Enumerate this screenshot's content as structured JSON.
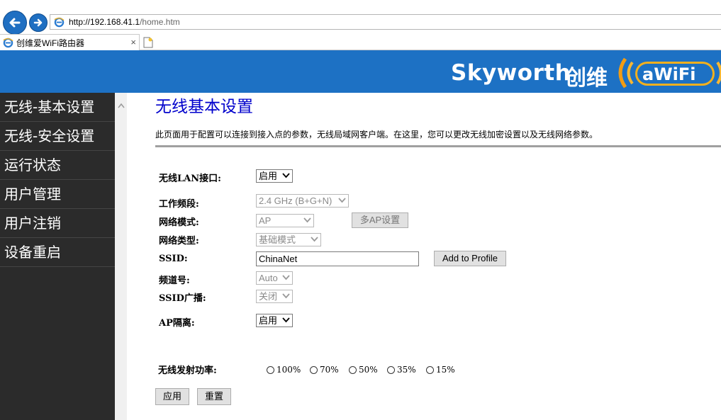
{
  "browser": {
    "url_host": "http://192.168.41.1",
    "url_path": "/home.htm",
    "tab_title": "创维爱WiFi路由器",
    "tab_close": "×"
  },
  "header": {
    "brand": "Skyworth",
    "brand_cn": "创维",
    "logo_text": "aWiFi",
    "color": "#1d71c4"
  },
  "sidebar": {
    "items": [
      {
        "label": "无线-基本设置"
      },
      {
        "label": "无线-安全设置"
      },
      {
        "label": "运行状态"
      },
      {
        "label": "用户管理"
      },
      {
        "label": "用户注销"
      },
      {
        "label": "设备重启"
      }
    ]
  },
  "main": {
    "title": "无线基本设置",
    "description": "此页面用于配置可以连接到接入点的参数，无线局域网客户端。在这里，您可以更改无线加密设置以及无线网络参数。",
    "fields": {
      "wlan_interface": {
        "label": "无线LAN接口:",
        "value": "启用"
      },
      "band": {
        "label": "工作频段:",
        "value": "2.4 GHz (B+G+N)"
      },
      "mode": {
        "label": "网络模式:",
        "value": "AP",
        "button": "多AP设置"
      },
      "network_type": {
        "label": "网络类型:",
        "value": "基础模式"
      },
      "ssid": {
        "label": "SSID:",
        "value": "ChinaNet",
        "button": "Add to Profile"
      },
      "channel": {
        "label": "频道号:",
        "value": "Auto"
      },
      "ssid_broadcast": {
        "label": "SSID广播:",
        "value": "关闭"
      },
      "ap_isolation": {
        "label": "AP隔离:",
        "value": "启用"
      },
      "tx_power": {
        "label": "无线发射功率:",
        "options": [
          "100%",
          "70%",
          "50%",
          "35%",
          "15%"
        ]
      }
    },
    "apply_label": "应用",
    "reset_label": "重置"
  }
}
